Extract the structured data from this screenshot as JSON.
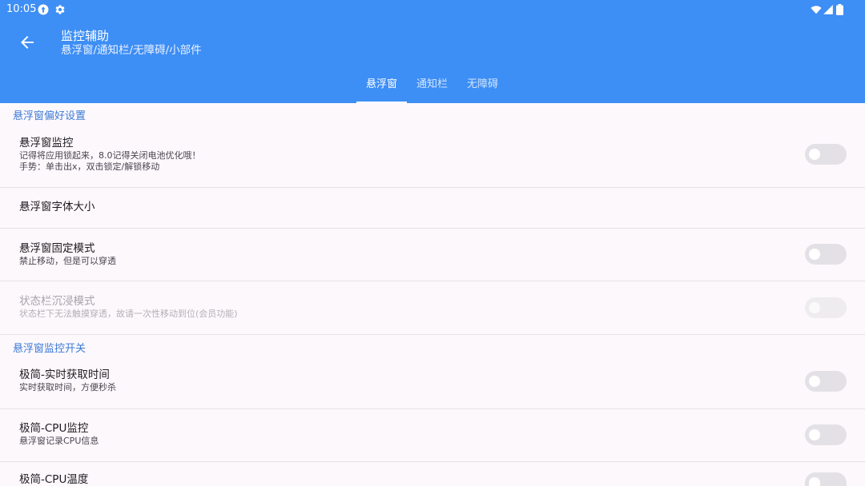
{
  "status_bar": {
    "time": "10:05",
    "left_icons": [
      "notification-icon",
      "settings-icon"
    ],
    "right_icons": [
      "wifi-icon",
      "signal-icon",
      "battery-icon"
    ]
  },
  "app_bar": {
    "back_icon": "arrow-back-icon",
    "title": "监控辅助",
    "subtitle": "悬浮窗/通知栏/无障碍/小部件"
  },
  "tabs": [
    {
      "label": "悬浮窗",
      "selected": true
    },
    {
      "label": "通知栏",
      "selected": false
    },
    {
      "label": "无障碍",
      "selected": false
    }
  ],
  "sections": [
    {
      "header": "悬浮窗偏好设置",
      "items": [
        {
          "title": "悬浮窗监控",
          "summary": [
            "记得将应用锁起来，8.0记得关闭电池优化哦！",
            "手势：单击出x，双击锁定/解锁移动"
          ],
          "switch_on": false,
          "enabled": true
        },
        {
          "title": "悬浮窗字体大小",
          "enabled": true
        },
        {
          "title": "悬浮窗固定模式",
          "summary": [
            "禁止移动，但是可以穿透"
          ],
          "switch_on": false,
          "enabled": true
        },
        {
          "title": "状态栏沉浸模式",
          "summary": [
            "状态栏下无法触摸穿透，故请一次性移动到位(会员功能)"
          ],
          "switch_on": false,
          "enabled": false
        }
      ]
    },
    {
      "header": "悬浮窗监控开关",
      "items": [
        {
          "title": "极简-实时获取时间",
          "summary": [
            "实时获取时间，方便秒杀"
          ],
          "switch_on": false,
          "enabled": true
        },
        {
          "title": "极简-CPU监控",
          "summary": [
            "悬浮窗记录CPU信息"
          ],
          "switch_on": false,
          "enabled": true
        },
        {
          "title": "极简-CPU温度",
          "switch_on": false,
          "enabled": true
        }
      ]
    }
  ],
  "colors": {
    "primary": "#3d8ef5",
    "section_header": "#3b7bd6",
    "background": "#fdf8fc",
    "switch_track_off": "#e4e1e6"
  }
}
